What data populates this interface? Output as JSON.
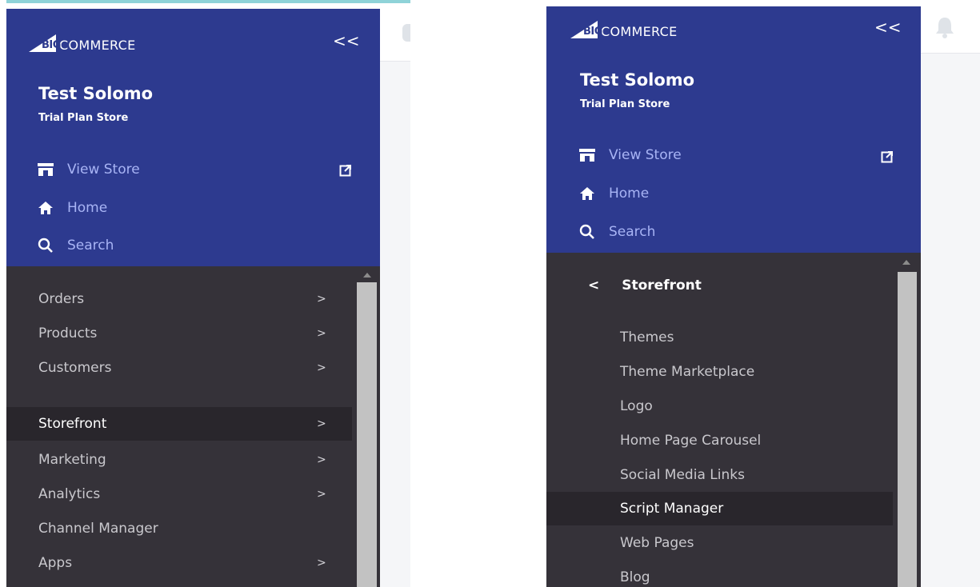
{
  "left_panel": {
    "brand": {
      "big": "BIG",
      "commerce": "COMMERCE"
    },
    "collapse_label": "<<",
    "store": {
      "name": "Test Solomo",
      "plan": "Trial Plan Store"
    },
    "quick_links": [
      {
        "label": "View Store",
        "icon": "storefront-icon"
      },
      {
        "label": "Home",
        "icon": "home-icon"
      },
      {
        "label": "Search",
        "icon": "search-icon"
      }
    ],
    "nav": [
      {
        "label": "Orders",
        "chevron": ">"
      },
      {
        "label": "Products",
        "chevron": ">"
      },
      {
        "label": "Customers",
        "chevron": ">"
      },
      {
        "label": "Storefront",
        "chevron": ">",
        "active": true
      },
      {
        "label": "Marketing",
        "chevron": ">"
      },
      {
        "label": "Analytics",
        "chevron": ">"
      },
      {
        "label": "Channel Manager",
        "chevron": ""
      },
      {
        "label": "Apps",
        "chevron": ">"
      }
    ]
  },
  "right_panel": {
    "brand": {
      "big": "BIG",
      "commerce": "COMMERCE"
    },
    "collapse_label": "<<",
    "store": {
      "name": "Test Solomo",
      "plan": "Trial Plan Store"
    },
    "quick_links": [
      {
        "label": "View Store",
        "icon": "storefront-icon"
      },
      {
        "label": "Home",
        "icon": "home-icon"
      },
      {
        "label": "Search",
        "icon": "search-icon"
      }
    ],
    "submenu_title": "Storefront",
    "back_glyph": "<",
    "submenu": [
      {
        "label": "Themes"
      },
      {
        "label": "Theme Marketplace"
      },
      {
        "label": "Logo"
      },
      {
        "label": "Home Page Carousel"
      },
      {
        "label": "Social Media Links"
      },
      {
        "label": "Script Manager",
        "active": true
      },
      {
        "label": "Web Pages"
      },
      {
        "label": "Blog"
      }
    ]
  },
  "colors": {
    "header_blue": "#2d3a8f",
    "link_blue": "#a8b4f5",
    "nav_dark": "#353239",
    "nav_active": "#29262c"
  }
}
